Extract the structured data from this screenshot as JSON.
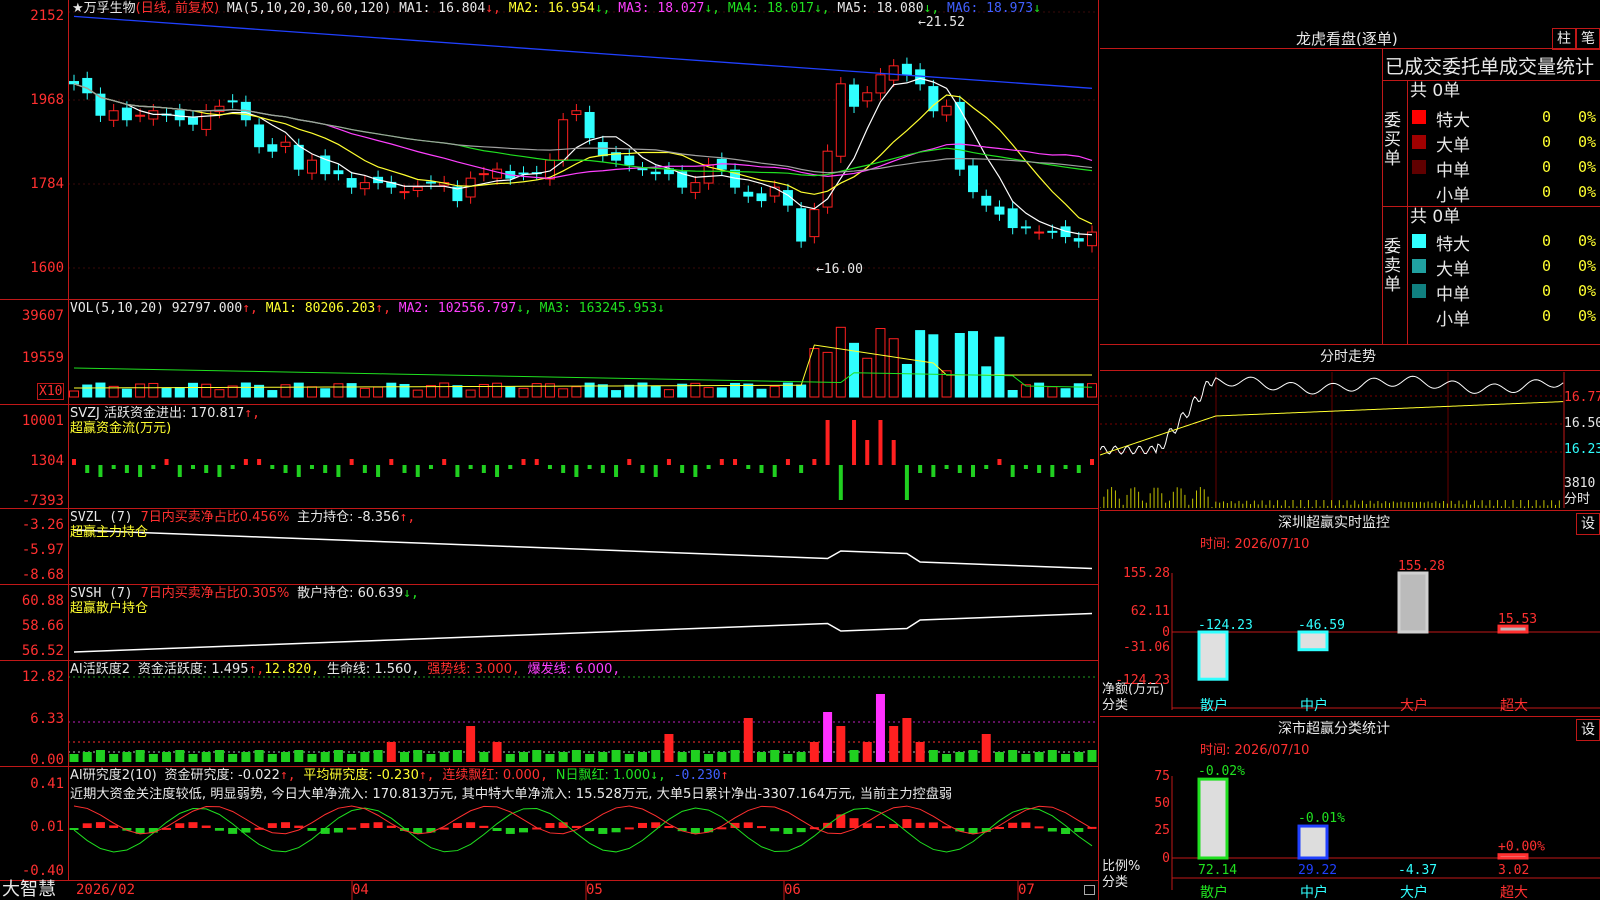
{
  "stock": {
    "title": "★万孚生物",
    "mode": "(日线, 前复权)"
  },
  "ma": {
    "label": "MA(5,10,20,30,60,120)",
    "ma1": "MA1: 16.804",
    "ma2": "MA2: 16.954",
    "ma3": "MA3: 18.027",
    "ma4": "MA4: 18.017",
    "ma5": "MA5: 18.080",
    "ma6": "MA6: 18.973"
  },
  "price_axis": [
    "2152",
    "1968",
    "1784",
    "1600"
  ],
  "price_marks": {
    "high": "21.52",
    "low": "16.00"
  },
  "vol": {
    "label": "VOL(5,10,20)",
    "value": "92797.000",
    "ma1": "MA1: 80206.203",
    "ma2": "MA2: 102556.797",
    "ma3": "MA3: 163245.953",
    "axis": [
      "39607",
      "19559"
    ],
    "unit": "X10"
  },
  "svzj": {
    "label": "SVZJ  活跃资金进出: 170.817",
    "sub": "超赢资金流(万元)",
    "axis": [
      "10001",
      "1304",
      "-7393"
    ]
  },
  "svzl": {
    "label": "SVZL (7)",
    "part2": "7日内买卖净占比0.456%",
    "part3": "主力持仓: -8.356",
    "sub": "超赢主力持仓",
    "axis": [
      "-3.26",
      "-5.97",
      "-8.68"
    ]
  },
  "svsh": {
    "label": "SVSH (7)",
    "part2": "7日内买卖净占比0.305%",
    "part3": "散户持仓: 60.639",
    "sub": "超赢散户持仓",
    "axis": [
      "60.88",
      "58.66",
      "56.52"
    ]
  },
  "ai1": {
    "label": "AI活跃度2",
    "part1": "资金活跃度: 1.495",
    "part2": "12.820",
    "part3": "生命线: 1.560",
    "part4": "强势线: 3.000",
    "part5": "爆发线: 6.000",
    "axis": [
      "12.82",
      "6.33",
      "0.00"
    ]
  },
  "ai2": {
    "label": "AI研究度2(10)",
    "part1": "资金研究度: -0.022",
    "part2": "平均研究度: -0.230",
    "part3": "连续飘红: 0.000",
    "part4": "N日飘红: 1.000",
    "part5": "-0.230",
    "axis": [
      "0.41",
      "0.01",
      "-0.40"
    ],
    "note": "近期大资金关注度较低, 明显弱势, 今日大单净流入: 170.813万元, 其中特大单净流入: 15.528万元, 大单5日累计净出-3307.164万元, 当前主力控盘弱"
  },
  "time_axis": [
    "2026/02",
    "04",
    "05",
    "06",
    "07"
  ],
  "brand": "大智慧",
  "dragon": {
    "title": "龙虎看盘(逐单)",
    "btn1": "柱",
    "btn2": "笔",
    "header": "已成交委托单成交量统计",
    "buy_label": "委买单",
    "sell_label": "委卖单",
    "buy_total": "共 0单",
    "sell_total": "共 0单",
    "rows_buy": [
      {
        "name": "特大",
        "val": "0",
        "pct": "0%",
        "color": "#ff0000"
      },
      {
        "name": "大单",
        "val": "0",
        "pct": "0%",
        "color": "#a00000"
      },
      {
        "name": "中单",
        "val": "0",
        "pct": "0%",
        "color": "#600000"
      },
      {
        "name": "小单",
        "val": "0",
        "pct": "0%",
        "color": ""
      }
    ],
    "rows_sell": [
      {
        "name": "特大",
        "val": "0",
        "pct": "0%",
        "color": "#30ffff"
      },
      {
        "name": "大单",
        "val": "0",
        "pct": "0%",
        "color": "#20a0a0"
      },
      {
        "name": "中单",
        "val": "0",
        "pct": "0%",
        "color": "#108080"
      },
      {
        "name": "小单",
        "val": "0",
        "pct": "0%",
        "color": ""
      }
    ]
  },
  "intraday": {
    "title": "分时走势",
    "axis": [
      "16.77",
      "16.50",
      "16.23"
    ],
    "vol_axis": "3810",
    "vol_label": "分时"
  },
  "monitor": {
    "title": "深圳超赢实时监控",
    "btn": "设",
    "time": "时间: 2026/07/10",
    "axis": [
      "155.28",
      "62.11",
      "0",
      "-31.06",
      "-124.23"
    ],
    "ylabel": "净额(万元)",
    "xlabel": "分类",
    "cats": [
      "散户",
      "中户",
      "大户",
      "超大"
    ],
    "values": [
      "-124.23",
      "-46.59",
      "155.28",
      "15.53"
    ]
  },
  "classify": {
    "title": "深市超赢分类统计",
    "btn": "设",
    "time": "时间: 2026/07/10",
    "axis": [
      "75",
      "50",
      "25",
      "0"
    ],
    "ylabel": "比例%",
    "xlabel": "分类",
    "cats": [
      "散户",
      "中户",
      "大户",
      "超大"
    ],
    "top": [
      "-0.02%",
      "-0.01%",
      "",
      "+0.00%"
    ],
    "bottom": [
      "72.14",
      "29.22",
      "-4.37",
      "3.02"
    ]
  },
  "chart_data": {
    "type": "candlestick",
    "title": "万孚生物 (日线, 前复权)",
    "ylim": [
      16.0,
      21.52
    ],
    "x": [
      "2026/02",
      "04",
      "05",
      "06",
      "07"
    ],
    "close": [
      20.1,
      19.9,
      19.4,
      19.5,
      19.3,
      19.4,
      19.5,
      19.4,
      19.3,
      19.2,
      19.5,
      19.6,
      19.7,
      19.3,
      18.7,
      18.6,
      18.8,
      18.2,
      18.4,
      18.1,
      18.1,
      17.8,
      17.9,
      17.9,
      17.8,
      17.7,
      17.8,
      17.9,
      17.9,
      17.5,
      18.0,
      18.1,
      18.2,
      18.0,
      18.1,
      18.1,
      18.4,
      19.3,
      19.5,
      18.9,
      18.5,
      18.4,
      18.3,
      18.2,
      18.1,
      18.1,
      17.8,
      17.9,
      18.3,
      18.2,
      17.8,
      17.6,
      17.5,
      17.8,
      17.4,
      16.6,
      17.3,
      18.6,
      20.1,
      19.6,
      19.9,
      20.3,
      20.5,
      20.3,
      20.1,
      19.5,
      19.6,
      18.2,
      17.7,
      17.4,
      17.2,
      16.9,
      16.9,
      16.8,
      16.8,
      16.7,
      16.6,
      16.8
    ],
    "series": [
      {
        "name": "MA1",
        "last": 16.804
      },
      {
        "name": "MA2",
        "last": 16.954
      },
      {
        "name": "MA3",
        "last": 18.027
      },
      {
        "name": "MA4",
        "last": 18.017
      },
      {
        "name": "MA5",
        "last": 18.08
      },
      {
        "name": "MA6",
        "last": 18.973
      }
    ]
  },
  "colors": {
    "up": "#ff2020",
    "down": "#30ffff",
    "frame": "#c01818",
    "ma1": "#ffffff",
    "ma2": "#ffff30",
    "ma3": "#ff40ff",
    "ma4": "#20e020",
    "ma5": "#a0a0a0",
    "ma6": "#2040ff"
  }
}
